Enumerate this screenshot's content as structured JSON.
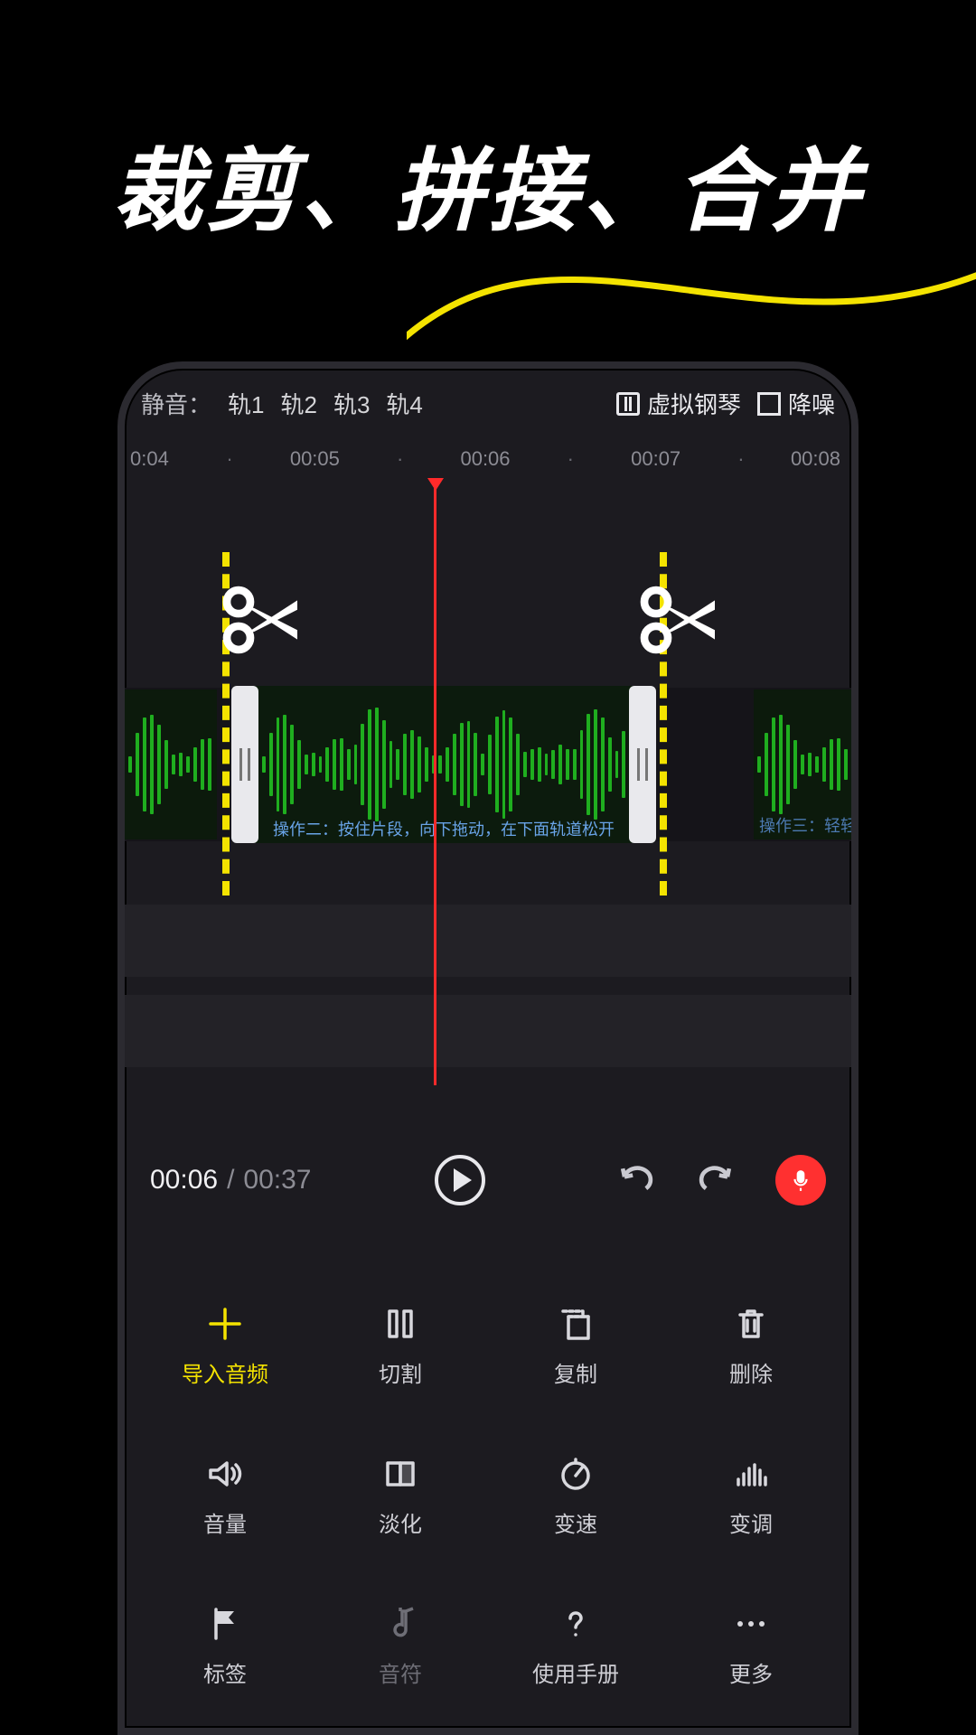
{
  "hero": {
    "title": "裁剪、拼接、合并"
  },
  "topbar": {
    "mute_label": "静音：",
    "tracks": [
      "轨1",
      "轨2",
      "轨3",
      "轨4"
    ],
    "piano_label": "虚拟钢琴",
    "denoise_label": "降噪"
  },
  "ruler": {
    "ticks": [
      "0:04",
      "00:05",
      "00:06",
      "00:07",
      "00:08"
    ]
  },
  "clip": {
    "caption_selected": "操作二：按住片段，向下拖动，在下面轨道松开",
    "caption_right": "操作三：轻轻"
  },
  "transport": {
    "current_time": "00:06",
    "time_separator": "/",
    "total_time": "00:37"
  },
  "tools": {
    "items": [
      {
        "key": "import",
        "label": "导入音频",
        "icon": "plus",
        "accent": true
      },
      {
        "key": "cut",
        "label": "切割",
        "icon": "split",
        "accent": false
      },
      {
        "key": "copy",
        "label": "复制",
        "icon": "copy",
        "accent": false
      },
      {
        "key": "delete",
        "label": "删除",
        "icon": "trash",
        "accent": false
      },
      {
        "key": "volume",
        "label": "音量",
        "icon": "speaker",
        "accent": false
      },
      {
        "key": "fade",
        "label": "淡化",
        "icon": "fade",
        "accent": false
      },
      {
        "key": "speed",
        "label": "变速",
        "icon": "gauge",
        "accent": false
      },
      {
        "key": "pitch",
        "label": "变调",
        "icon": "eq",
        "accent": false
      },
      {
        "key": "marker",
        "label": "标签",
        "icon": "flag",
        "accent": false
      },
      {
        "key": "note",
        "label": "音符",
        "icon": "note",
        "accent": false,
        "dim": true
      },
      {
        "key": "manual",
        "label": "使用手册",
        "icon": "help",
        "accent": false
      },
      {
        "key": "more",
        "label": "更多",
        "icon": "dots",
        "accent": false
      }
    ]
  }
}
